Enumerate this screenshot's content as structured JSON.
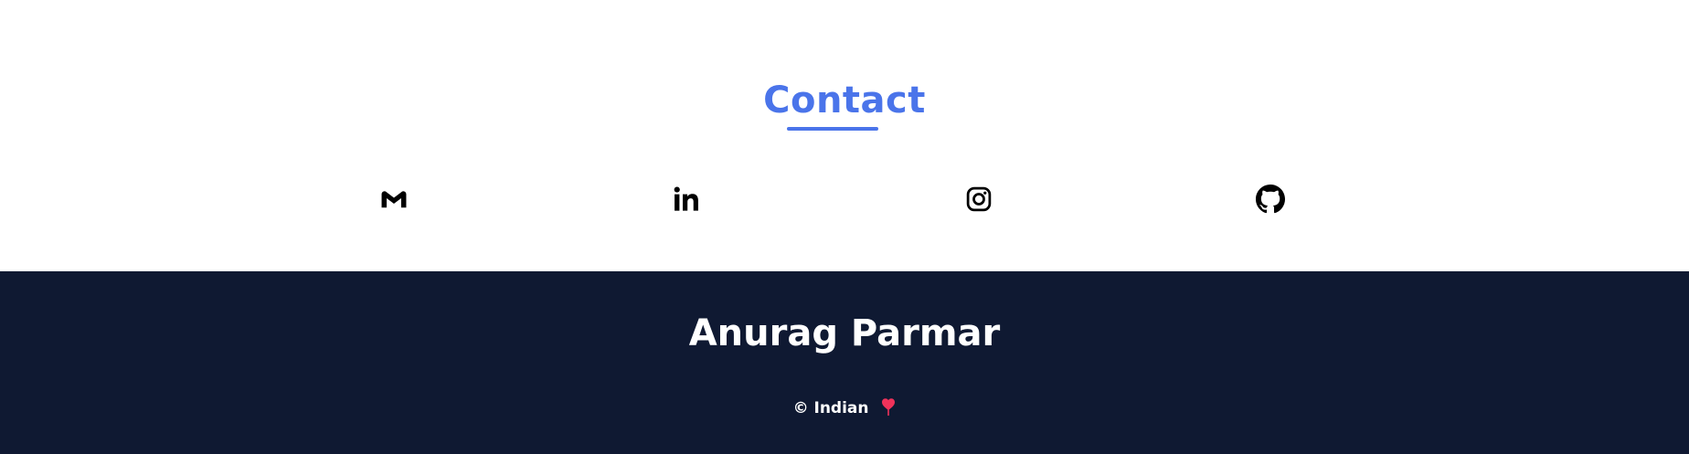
{
  "contact": {
    "title": "Contact",
    "accent_color": "#4a74ea",
    "links": [
      {
        "icon": "gmail-icon"
      },
      {
        "icon": "linkedin-icon"
      },
      {
        "icon": "instagram-icon"
      },
      {
        "icon": "github-icon"
      }
    ]
  },
  "footer": {
    "name": "Anurag Parmar",
    "copyright": "© Indian",
    "heart_color": "#f0325a",
    "background_color": "#0f1932"
  }
}
